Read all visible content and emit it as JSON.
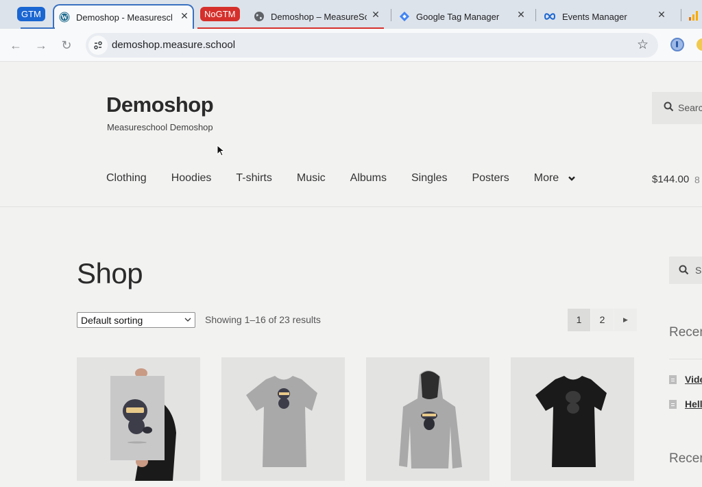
{
  "browser": {
    "tabs": [
      {
        "group_label": "GTM",
        "group_color": "#1a66d2",
        "title": "Demoshop - Measureschool",
        "favicon": "wordpress-icon",
        "active": true
      },
      {
        "group_label": "NoGTM",
        "group_color": "#d5302b",
        "title": "Demoshop – MeasureSchool",
        "favicon": "globe-icon",
        "active": false
      },
      {
        "title": "Google Tag Manager",
        "favicon": "gtm-icon",
        "active": false
      },
      {
        "title": "Events Manager",
        "favicon": "meta-icon",
        "active": false
      }
    ],
    "address_bar": {
      "url": "demoshop.measure.school"
    },
    "nav": {
      "back_icon": "←",
      "forward_icon": "→",
      "reload_icon": "↻",
      "star_icon": "☆",
      "close_icon": "✕"
    }
  },
  "site": {
    "title": "Demoshop",
    "tagline": "Measureschool Demoshop",
    "header_search_placeholder": "Search products…",
    "header_search_visible": "Searc",
    "nav": [
      "Clothing",
      "Hoodies",
      "T-shirts",
      "Music",
      "Albums",
      "Singles",
      "Posters"
    ],
    "nav_more": "More",
    "cart_total": "$144.00",
    "cart_count_visible": "8"
  },
  "shop": {
    "title": "Shop",
    "sorting_selected": "Default sorting",
    "result_count": "Showing 1–16 of 23 results",
    "pagination": {
      "pages": [
        "1",
        "2"
      ],
      "current": "1",
      "next_icon": "▶"
    },
    "products": [
      {
        "name": "poster-ninja",
        "kind": "poster"
      },
      {
        "name": "tshirt-grey-ninja",
        "kind": "tshirt-grey"
      },
      {
        "name": "hoodie-grey-ninja",
        "kind": "hoodie"
      },
      {
        "name": "tshirt-black",
        "kind": "tshirt-black"
      }
    ]
  },
  "sidebar": {
    "search_visible": "S",
    "widget_recent_posts_title": "Recent Posts",
    "recent_posts_visible": [
      "Vide",
      "Hell"
    ],
    "widget_recent_comments_title": "Recent Comments"
  }
}
